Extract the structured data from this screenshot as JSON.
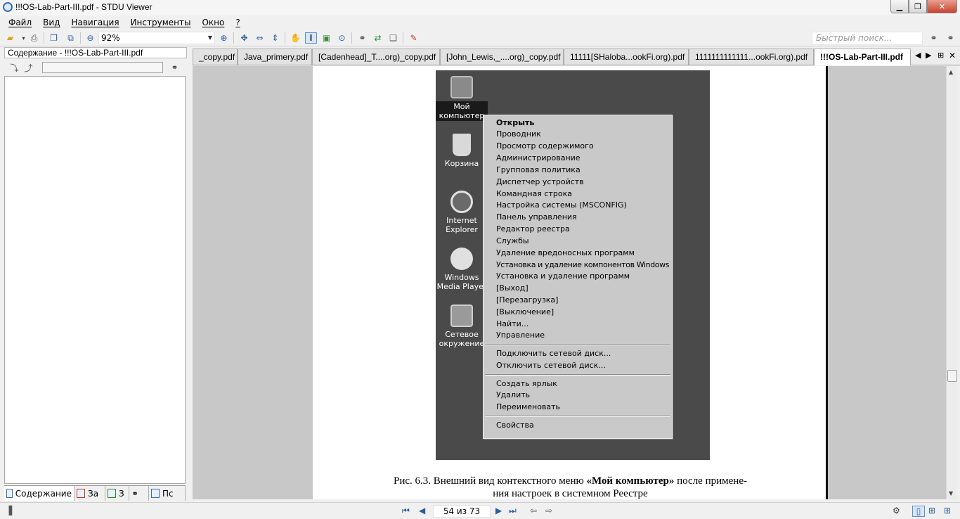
{
  "window": {
    "title": "!!!OS-Lab-Part-III.pdf - STDU Viewer"
  },
  "menu": [
    "Файл",
    "Вид",
    "Навигация",
    "Инструменты",
    "Окно",
    "?"
  ],
  "toolbar": {
    "zoom": "92%",
    "search_placeholder": "Быстрый поиск..."
  },
  "left_panel": {
    "title": "Содержание - !!!OS-Lab-Part-III.pdf",
    "tabs": [
      "Содержание",
      "За",
      "З",
      "",
      "Пс"
    ]
  },
  "tabs": [
    "_copy.pdf",
    "Java_primery.pdf",
    "[Cadenhead]_T....org)_copy.pdf",
    "[John_Lewis,_....org)_copy.pdf",
    "11111[SHaloba...ookFi.org).pdf",
    "1111111111111...ookFi.org).pdf",
    "!!!OS-Lab-Part-III.pdf"
  ],
  "desktop_icons": [
    {
      "label": "Мой компьютер",
      "icon": "my-computer-icon"
    },
    {
      "label": "Корзина",
      "icon": "recycle-bin-icon"
    },
    {
      "label": "Internet Explorer",
      "icon": "internet-explorer-icon"
    },
    {
      "label": "Windows Media Player",
      "icon": "media-player-icon"
    },
    {
      "label": "Сетевое окружение",
      "icon": "network-icon"
    }
  ],
  "context_menu": {
    "group1": [
      "Открыть",
      "Проводник",
      "Просмотр содержимого",
      "Администрирование",
      "Групповая политика",
      "Диспетчер устройств",
      "Командная строка",
      "Настройка системы (MSCONFIG)",
      "Панель управления",
      "Редактор реестра",
      "Службы",
      "Удаление вредоносных программ",
      "Установка и удаление компонентов Windows",
      "Установка и удаление программ",
      "[Выход]",
      "[Перезагрузка]",
      "[Выключение]",
      "Найти...",
      "Управление"
    ],
    "group2": [
      "Подключить сетевой диск...",
      "Отключить сетевой диск..."
    ],
    "group3": [
      "Создать ярлык",
      "Удалить",
      "Переименовать"
    ],
    "group4": [
      "Свойства"
    ]
  },
  "caption": {
    "prefix": "Рис. 6.3. Внешний вид контекстного меню ",
    "bold": "«Мой компьютер»",
    "suffix": " после примене-",
    "line2": "ния настроек в системном Реестре"
  },
  "status": {
    "page": "54 из 73"
  }
}
